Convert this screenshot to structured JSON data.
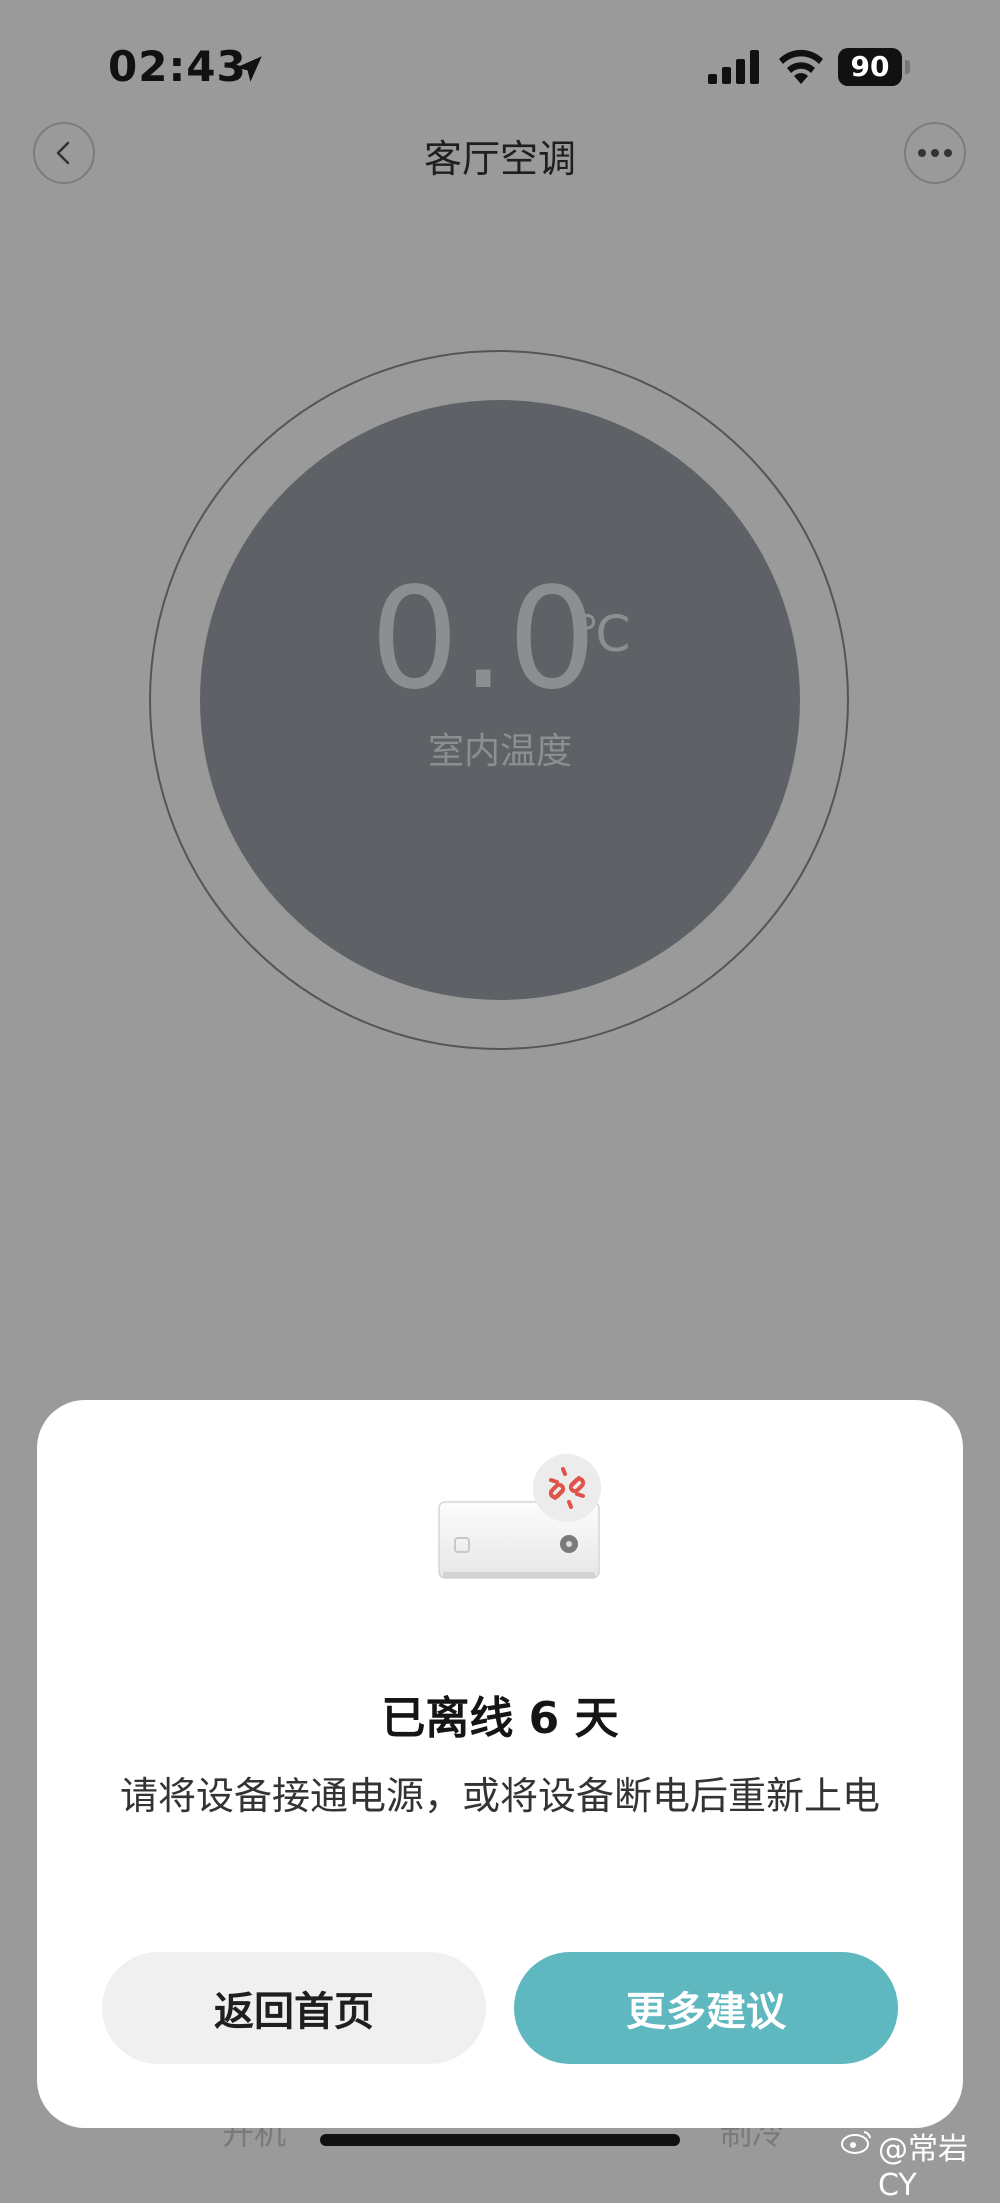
{
  "status_bar": {
    "time": "02:43",
    "battery": "90"
  },
  "header": {
    "title": "客厅空调"
  },
  "dial": {
    "value": "0.0",
    "unit": "℃",
    "label": "室内温度"
  },
  "behind_labels": {
    "left": "开机",
    "right": "制冷"
  },
  "sheet": {
    "title": "已离线 6 天",
    "description": "请将设备接通电源，或将设备断电后重新上电",
    "home_button": "返回首页",
    "more_button": "更多建议"
  },
  "watermark": "@常岩CY",
  "colors": {
    "accent": "#5fb7bf",
    "overlay": "#9a9a9a",
    "dial": "#5e6166",
    "offline_icon": "#e0534a"
  }
}
